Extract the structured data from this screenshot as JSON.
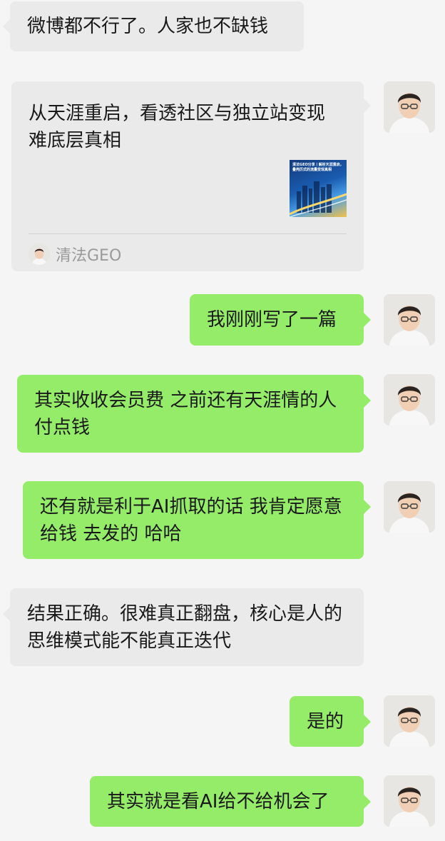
{
  "messages": [
    {
      "id": "m1",
      "direction": "incoming",
      "text": "微博都不行了。人家也不缺钱"
    },
    {
      "id": "m2",
      "direction": "incoming",
      "type": "link-card",
      "card": {
        "title": "从天涯重启，看透社区与独立站变现难底层真相",
        "thumb_text": "清法GEO分享丨解析天涯重启，叠壳历式的流量变现真相",
        "source": "清法GEO"
      }
    },
    {
      "id": "m3",
      "direction": "outgoing",
      "text": "我刚刚写了一篇"
    },
    {
      "id": "m4",
      "direction": "outgoing",
      "text": "其实收收会员费  之前还有天涯情的人 付点钱"
    },
    {
      "id": "m5",
      "direction": "outgoing",
      "text": "还有就是利于AI抓取的话 我肯定愿意给钱 去发的 哈哈"
    },
    {
      "id": "m6",
      "direction": "incoming",
      "text": "结果正确。很难真正翻盘，核心是人的思维模式能不能真正迭代"
    },
    {
      "id": "m7",
      "direction": "outgoing",
      "text": "是的"
    },
    {
      "id": "m8",
      "direction": "outgoing",
      "text": "其实就是看AI给不给机会了"
    }
  ],
  "colors": {
    "background": "#f5f5f5",
    "incoming_bubble": "#eaeaea",
    "outgoing_bubble": "#95ec69",
    "text": "#191919",
    "meta_text": "#9a9a9a"
  },
  "icons": {
    "avatar": "user-avatar-icon"
  }
}
